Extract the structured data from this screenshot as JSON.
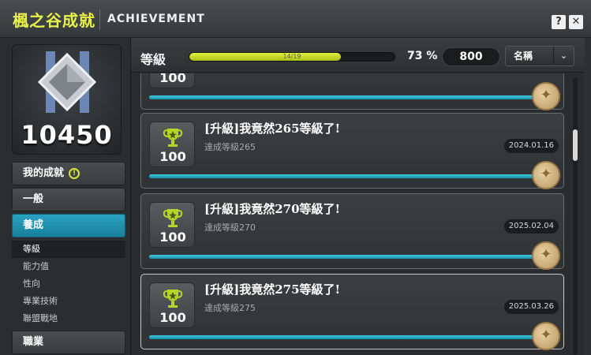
{
  "window": {
    "title": "楓之谷成就",
    "subtitle": "ACHIEVEMENT",
    "help_label": "?",
    "close_label": "✕"
  },
  "profile": {
    "score": "10450",
    "emblem_icon": "diamond-emblem-icon"
  },
  "sidebar": {
    "items": [
      {
        "label": "我的成就",
        "icon": "info-icon"
      },
      {
        "label": "一般"
      },
      {
        "label": "養成"
      }
    ],
    "sub_items": [
      "等級",
      "能力值",
      "性向",
      "專業技術",
      "聯盟戰地"
    ],
    "bottom_item": "職業"
  },
  "header": {
    "category": "等級",
    "progress_text": "14/19",
    "progress_fraction": 0.737,
    "percent": "73 %",
    "points": "800",
    "sort_selected": "名稱",
    "sort_arrow": "⌄"
  },
  "achievements": [
    {
      "title": "",
      "desc": "",
      "date": "",
      "points": "100"
    },
    {
      "title": "[升級]我竟然265等級了!",
      "desc": "達成等級265",
      "date": "2024.01.16",
      "points": "100"
    },
    {
      "title": "[升級]我竟然270等級了!",
      "desc": "達成等級270",
      "date": "2025.02.04",
      "points": "100"
    },
    {
      "title": "[升級]我竟然275等級了!",
      "desc": "達成等級275",
      "date": "2025.03.26",
      "points": "100"
    }
  ],
  "colors": {
    "accent_yellow": "#e8f24a",
    "active_tab": "#1a8fa8",
    "progress_fill": "#cce01f",
    "card_bar": "#2bb0cc"
  }
}
